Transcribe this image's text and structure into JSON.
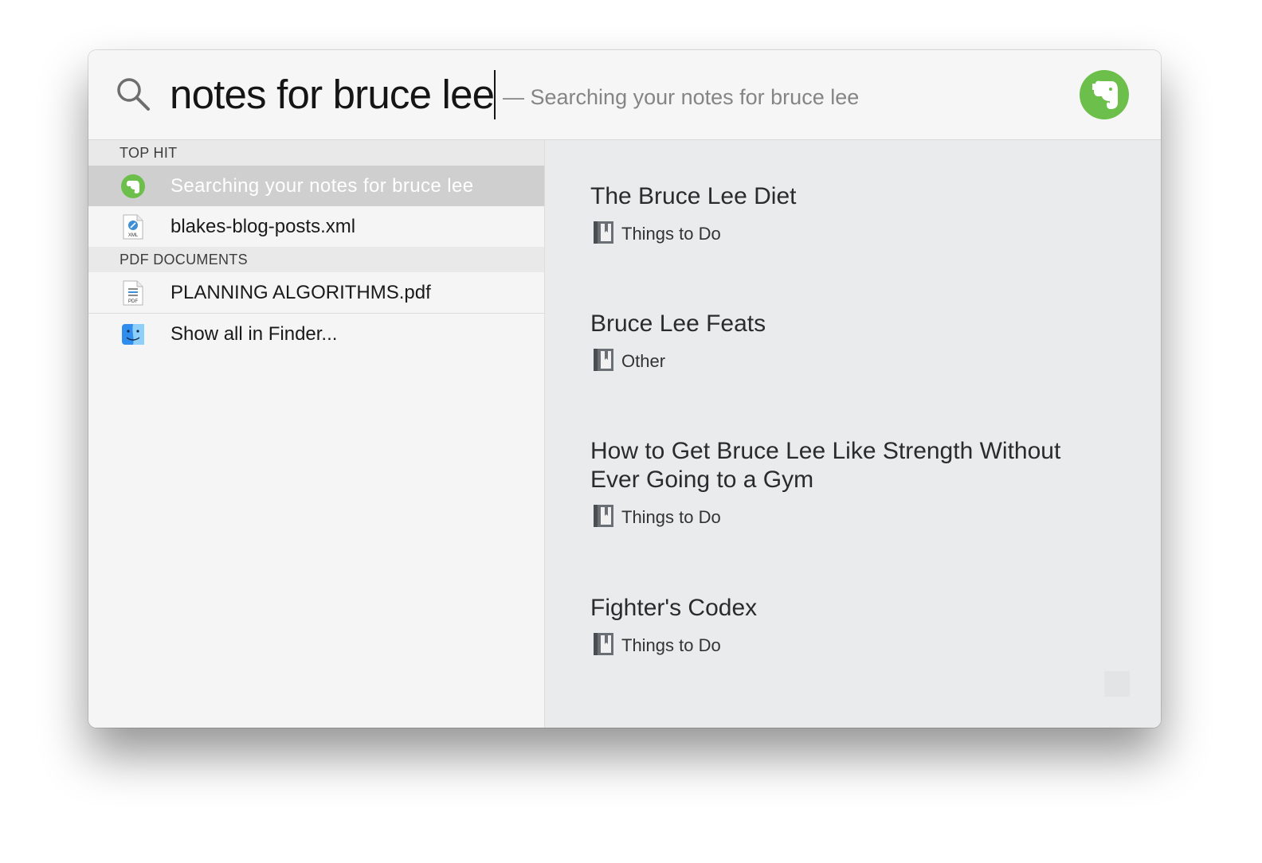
{
  "search": {
    "query": "notes for bruce lee",
    "suggestion": "— Searching your notes for bruce lee",
    "app_icon": "evernote-elephant-icon",
    "accent_color": "#6bbf4a"
  },
  "results": {
    "sections": [
      {
        "header": "TOP HIT",
        "items": [
          {
            "label": "Searching your notes for bruce lee",
            "icon": "evernote-icon",
            "selected": true
          },
          {
            "label": "blakes-blog-posts.xml",
            "icon": "xml-file-icon",
            "selected": false
          }
        ]
      },
      {
        "header": "PDF DOCUMENTS",
        "items": [
          {
            "label": "PLANNING ALGORITHMS.pdf",
            "icon": "pdf-file-icon",
            "selected": false
          }
        ]
      }
    ],
    "finder": {
      "label": "Show all in Finder...",
      "icon": "finder-icon"
    }
  },
  "preview": {
    "notes": [
      {
        "title": "The Bruce Lee Diet",
        "notebook": "Things to Do"
      },
      {
        "title": "Bruce Lee Feats",
        "notebook": "Other"
      },
      {
        "title": "How to Get Bruce Lee Like Strength Without Ever Going to a Gym",
        "notebook": "Things to Do"
      },
      {
        "title": "Fighter's Codex",
        "notebook": "Things to Do"
      }
    ]
  }
}
